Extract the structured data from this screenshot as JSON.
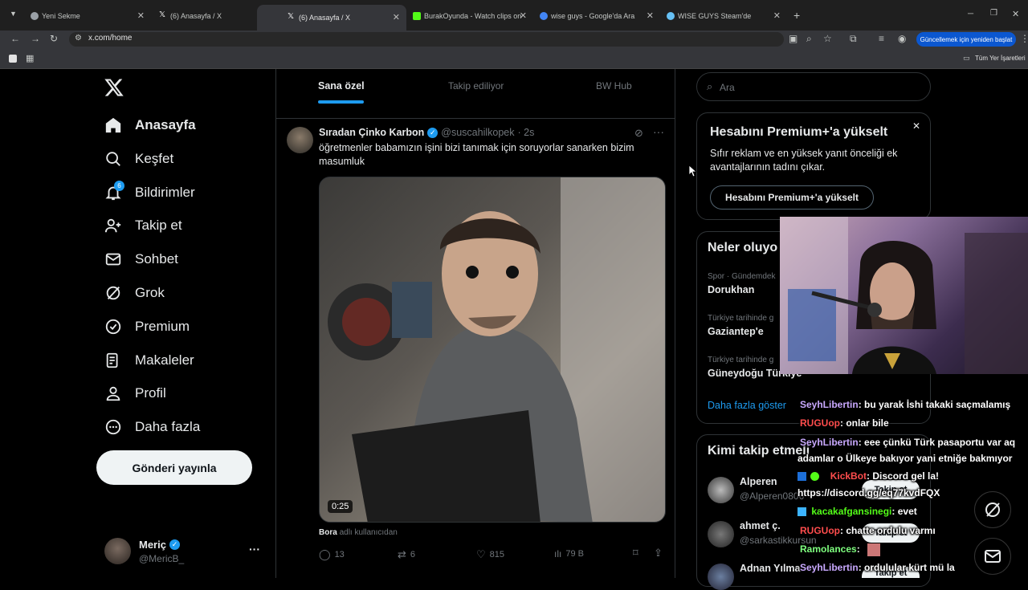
{
  "browser": {
    "tabs": [
      {
        "title": "Yeni Sekme",
        "favicon_color": "#9aa0a6"
      },
      {
        "title": "(6) Anasayfa / X",
        "favicon_color": "#ffffff"
      },
      {
        "title": "(6) Anasayfa / X",
        "favicon_color": "#ffffff"
      },
      {
        "title": "BurakOyunda - Watch clips on",
        "favicon_color": "#53fc18"
      },
      {
        "title": "wise guys - Google'da Ara",
        "favicon_color": "#4285f4"
      },
      {
        "title": "WISE GUYS Steam'de",
        "favicon_color": "#66c0f4"
      }
    ],
    "new_tab": "+",
    "url": "x.com/home",
    "update_button": "Güncellemek için yeniden başlat",
    "bookmarks_all": "Tüm Yer İşaretleri"
  },
  "nav": {
    "items": [
      {
        "label": "Anasayfa",
        "icon": "home-icon"
      },
      {
        "label": "Keşfet",
        "icon": "search-icon"
      },
      {
        "label": "Bildirimler",
        "icon": "bell-icon",
        "badge": "6"
      },
      {
        "label": "Takip et",
        "icon": "follow-icon"
      },
      {
        "label": "Sohbet",
        "icon": "mail-icon"
      },
      {
        "label": "Grok",
        "icon": "grok-icon"
      },
      {
        "label": "Premium",
        "icon": "verified-icon"
      },
      {
        "label": "Makaleler",
        "icon": "article-icon"
      },
      {
        "label": "Profil",
        "icon": "profile-icon"
      },
      {
        "label": "Daha fazla",
        "icon": "more-icon"
      }
    ],
    "post_button": "Gönderi yayınla",
    "account": {
      "name": "Meriç",
      "handle": "@MericB_",
      "more": "···"
    }
  },
  "feed": {
    "tabs": [
      "Sana özel",
      "Takip ediliyor",
      "BW Hub"
    ],
    "tweet": {
      "author": "Sıradan Çinko Karbon",
      "handle": "@suscahilkopek",
      "time": "· 2s",
      "text": "öğretmenler babamızın işini bizi tanımak için soruyorlar sanarken bizim masumluk",
      "video_duration": "0:25",
      "source_user": "Bora",
      "source_text": "adlı kullanıcıdan",
      "replies": "13",
      "retweets": "6",
      "likes": "815",
      "views": "79 B"
    }
  },
  "sidebar": {
    "search_placeholder": "Ara",
    "premium": {
      "title": "Hesabını Premium+'a yükselt",
      "body": "Sıfır reklam ve en yüksek yanıt önceliği ek avantajlarının tadını çıkar.",
      "button": "Hesabını Premium+'a yükselt"
    },
    "trends": {
      "title": "Neler oluyo",
      "items": [
        {
          "context": "Spor · Gündemdek",
          "name": "Dorukhan"
        },
        {
          "context": "Türkiye tarihinde g",
          "name": "Gaziantep'e"
        },
        {
          "context": "Türkiye tarihinde g",
          "name": "Güneydoğu Türkiye"
        }
      ],
      "show_more": "Daha fazla göster"
    },
    "who_to_follow": {
      "title": "Kimi takip etmeli",
      "users": [
        {
          "name": "Alperen",
          "handle": "@Alperen0806"
        },
        {
          "name": "ahmet ç.",
          "handle": "@sarkastikkursun"
        },
        {
          "name": "Adnan Yılma",
          "handle": ""
        }
      ],
      "follow_label": "Takip et"
    }
  },
  "chat": [
    {
      "user": "SeyhLibertin",
      "color": "#c9a9ff",
      "msg": ": bu yarak İshi takaki saçmalamış"
    },
    {
      "user": "RUGUop",
      "color": "#ff4d4d",
      "msg": ": onlar bile"
    },
    {
      "user": "SeyhLibertin",
      "color": "#c9a9ff",
      "msg": ": eee çünkü Türk pasaportu var aq"
    },
    {
      "user": "",
      "color": "#ffffff",
      "msg": "adamlar o Ülkeye bakıyor yani etniğe bakmıyor"
    },
    {
      "user": "KickBot",
      "color": "#ff4d4d",
      "msg": ": Discord gel la!"
    },
    {
      "user": "",
      "color": "#ffffff",
      "msg": "https://discord.gg/eq77kvdFQX"
    },
    {
      "user": "kacakafgansinegi",
      "color": "#53fc18",
      "msg": ": evet"
    },
    {
      "user": "RUGUop",
      "color": "#ff4d4d",
      "msg": ": chatte ordulu varmı"
    },
    {
      "user": "Ramolances",
      "color": "#7fff7f",
      "msg": ":"
    },
    {
      "user": "SeyhLibertin",
      "color": "#c9a9ff",
      "msg": ": ordulular kürt mü la"
    }
  ]
}
